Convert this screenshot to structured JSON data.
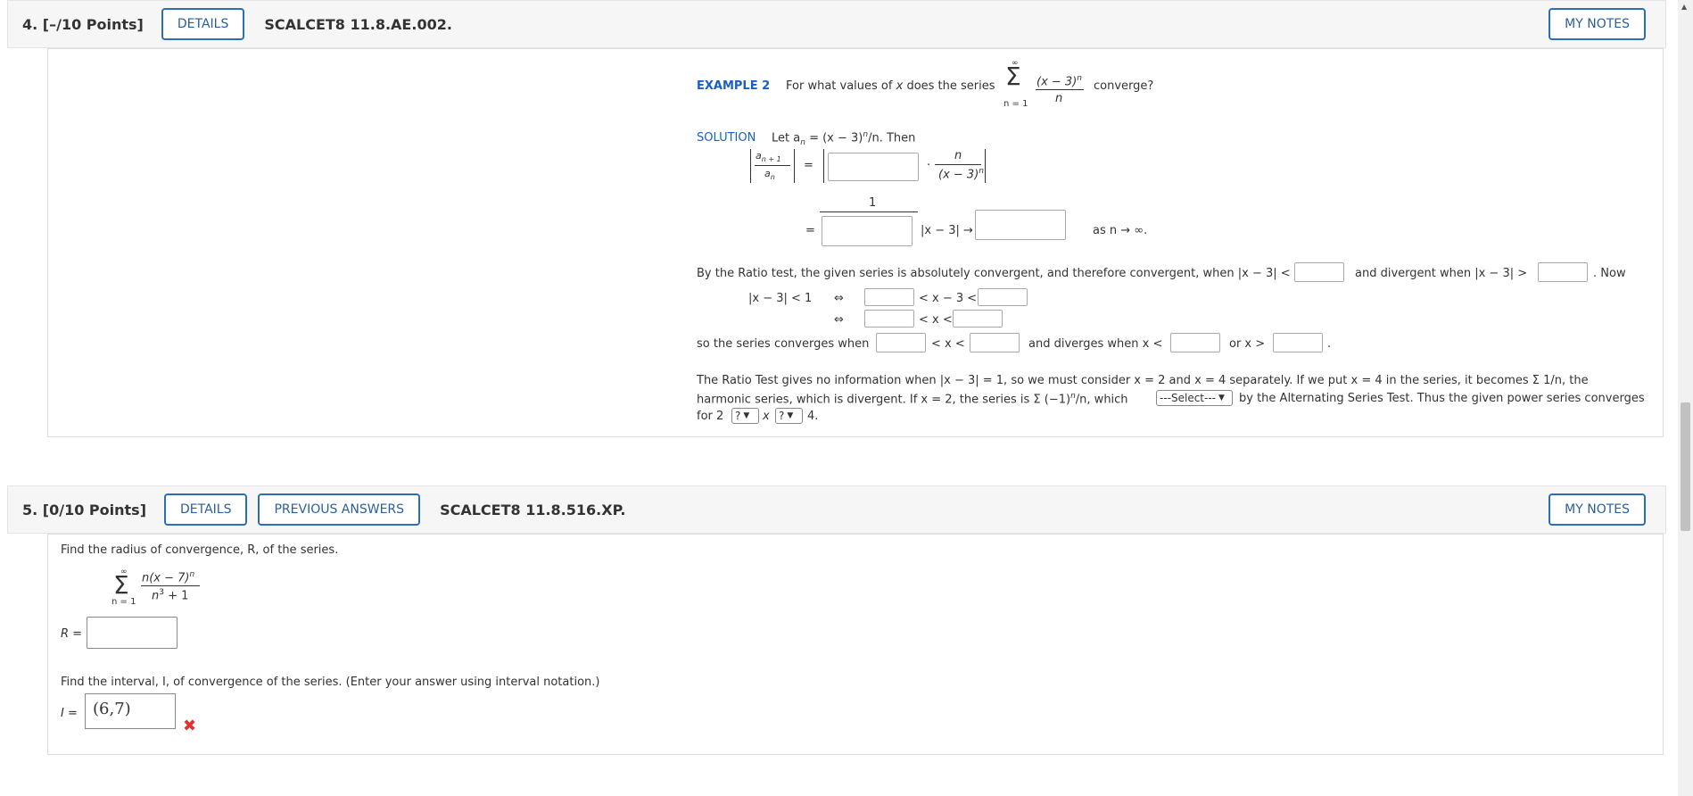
{
  "q4": {
    "number": "4.",
    "points": "[–/10 Points]",
    "details": "DETAILS",
    "id": "SCALCET8 11.8.AE.002.",
    "mynotes": "MY NOTES",
    "example_label": "EXAMPLE 2",
    "example_q1": "For what values of",
    "var_x": "x",
    "example_q2": "does the series",
    "sigma": "Σ",
    "inf": "∞",
    "n_eq_1": "n = 1",
    "series_num": "(x − 3)",
    "sup_n": "n",
    "series_den": "n",
    "converge": "converge?",
    "solution_label": "SOLUTION",
    "let_text": "Let a",
    "let_rest": " = (x − 3)",
    "let_tail": "/n.  Then",
    "ratio_num": "a",
    "ratio_num_sub": "n + 1",
    "ratio_den": "a",
    "ratio_den_sub": "n",
    "eq": "=",
    "dot": "·",
    "frac2_num": "n",
    "frac2_den": "(x − 3)",
    "one": "1",
    "absx": "|x − 3| →",
    "as_n": "as n → ∞.",
    "ratio_test_text": "By the Ratio test, the given series is absolutely convergent, and therefore convergent, when  |x − 3| <",
    "divergent_when": "and divergent when  |x − 3| >",
    "now": ". Now",
    "ineq1": "|x − 3| < 1",
    "iff": "⇔",
    "lt_x3_lt": "< x − 3 <",
    "lt_x_lt": "< x <",
    "so_series": "so the series converges when",
    "diverges_when": "and diverges when  x <",
    "or_x": "or  x >",
    "period": ".",
    "ratio_info_line1": "The Ratio Test gives no information when  |x − 3| = 1,  so we must consider  x = 2  and  x = 4  separately. If we put  x = 4  in the series, it becomes  Σ 1/n,  the",
    "ratio_info_line2a": "harmonic series, which is divergent. If  x = 2,  the series is  Σ (−1)",
    "ratio_info_line2b": "/n,  which",
    "select_label": "---Select---",
    "ratio_info_line2c": "by the Alternating Series Test. Thus the given power series converges",
    "for_2": "for  2",
    "q_mark": "?",
    "x_mid": "x",
    "four": "4."
  },
  "q5": {
    "number": "5.",
    "points": "[0/10 Points]",
    "details": "DETAILS",
    "prev_answers": "PREVIOUS ANSWERS",
    "id": "SCALCET8 11.8.516.XP.",
    "mynotes": "MY NOTES",
    "find_radius": "Find the radius of convergence, R, of the series.",
    "sigma": "Σ",
    "inf": "∞",
    "n_eq_1": "n = 1",
    "series_num": "n(x − 7)",
    "sup_n": "n",
    "series_den": "n",
    "sup_3": "3",
    "series_den_tail": " + 1",
    "r_label": "R =",
    "find_interval": "Find the interval, I, of convergence of the series. (Enter your answer using interval notation.)",
    "i_label": "I =",
    "i_answer": "(6,7)",
    "wrong_mark": "✖"
  },
  "colors": {
    "accent": "#2a6ebb",
    "blue_text": "#1a5fc7",
    "wrong": "#e03030"
  }
}
